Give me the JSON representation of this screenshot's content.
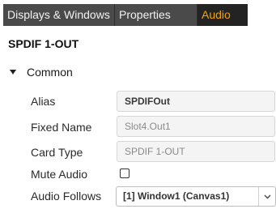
{
  "tabs": [
    {
      "label": "Displays & Windows",
      "active": false
    },
    {
      "label": "Properties",
      "active": false
    },
    {
      "label": "Audio",
      "active": true
    }
  ],
  "colors": {
    "tab_bar_bg": "#4a4a4a",
    "active_tab_bg": "#232323",
    "active_tab_text": "#f5a30a"
  },
  "panel": {
    "title": "SPDIF 1-OUT",
    "group": {
      "label": "Common",
      "expanded": true,
      "icon": "caret-down-icon"
    },
    "properties": {
      "alias": {
        "label": "Alias",
        "value": "SPDIFOut"
      },
      "fixed_name": {
        "label": "Fixed Name",
        "value": "Slot4.Out1"
      },
      "card_type": {
        "label": "Card Type",
        "value": "SPDIF 1-OUT"
      },
      "mute_audio": {
        "label": "Mute Audio",
        "checked": false
      },
      "audio_follows": {
        "label": "Audio Follows",
        "value": "[1] Window1 (Canvas1)",
        "icon": "chevron-down-icon"
      }
    }
  }
}
